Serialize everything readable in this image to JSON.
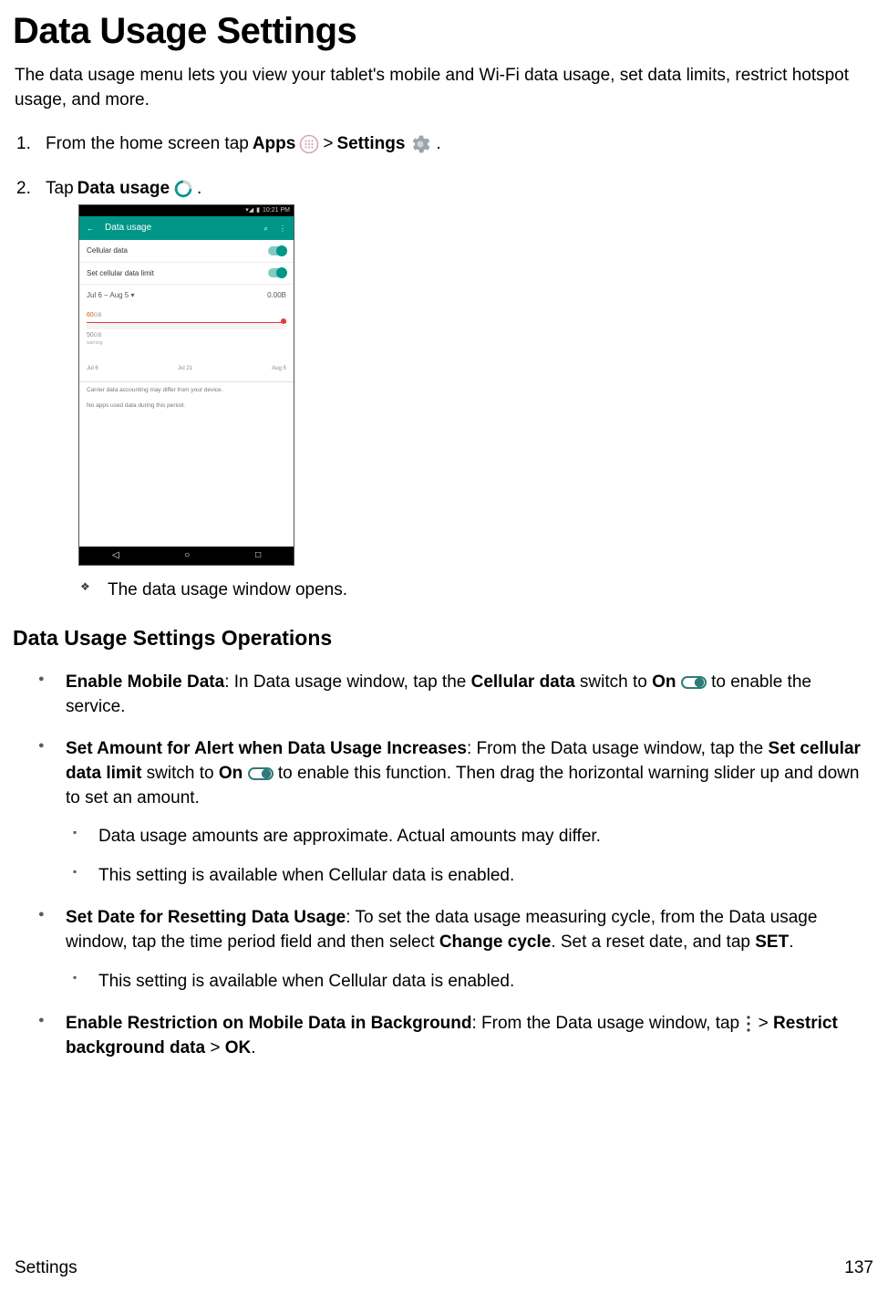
{
  "page": {
    "title": "Data Usage Settings",
    "intro": "The data usage menu lets you view your tablet's mobile and Wi-Fi data usage, set data limits, restrict hotspot usage, and more.",
    "section_heading": "Data Usage Settings Operations",
    "footer_left": "Settings",
    "footer_right": "137"
  },
  "steps": {
    "s1": {
      "num": "1.",
      "t1": "From the home screen tap ",
      "apps_bold": "Apps",
      "gt1": " > ",
      "settings_bold": "Settings",
      "dot": "."
    },
    "s2": {
      "num": "2.",
      "t1": "Tap ",
      "du_bold": "Data usage",
      "dot": "."
    },
    "result": "The data usage window opens."
  },
  "phone": {
    "time": "10:21 PM",
    "app_title": "Data usage",
    "row1": "Cellular data",
    "row2": "Set cellular data limit",
    "cycle": "Jul 6 – Aug 5",
    "cycle_arrow": "▾",
    "cycle_val": "0.00B",
    "sixty": "60",
    "sixty_unit": "GB",
    "fifty": "50",
    "fifty_unit": "GB",
    "warn": "warning",
    "t1": "Jul 6",
    "t2": "Jul 21",
    "t3": "Aug 5",
    "info1": "Carrier data accounting may differ from your device.",
    "info2": "No apps used data during this period."
  },
  "ops": {
    "b1": {
      "title": "Enable Mobile Data",
      "t1": ": In Data usage window, tap the ",
      "b_cell": "Cellular data",
      "t2": " switch to ",
      "b_on": "On",
      "t3": " to enable the service."
    },
    "b2": {
      "title": "Set Amount for Alert when Data Usage Increases",
      "t1": ": From the Data usage window, tap the ",
      "b_set": "Set cellular data limit",
      "t2": " switch to ",
      "b_on": "On",
      "t3": " to enable this function. Then drag the horizontal warning slider up and down to set an amount.",
      "sub1": "Data usage amounts are approximate. Actual amounts may differ.",
      "sub2": "This setting is available when Cellular data is enabled."
    },
    "b3": {
      "title": "Set Date for Resetting Data Usage",
      "t1": ": To set the data usage measuring cycle, from the Data usage window, tap the time period field and then select ",
      "b_change": "Change cycle",
      "t2": ". Set a reset date, and tap ",
      "b_setbtn": "SET",
      "t3": ".",
      "sub1": "This setting is available when Cellular data is enabled."
    },
    "b4": {
      "title": "Enable Restriction on Mobile Data in Background",
      "t1": ": From the Data usage window, tap ",
      "gt": " > ",
      "b_restrict": "Restrict background data",
      "gt2": " > ",
      "b_ok": "OK",
      "dot": "."
    }
  }
}
